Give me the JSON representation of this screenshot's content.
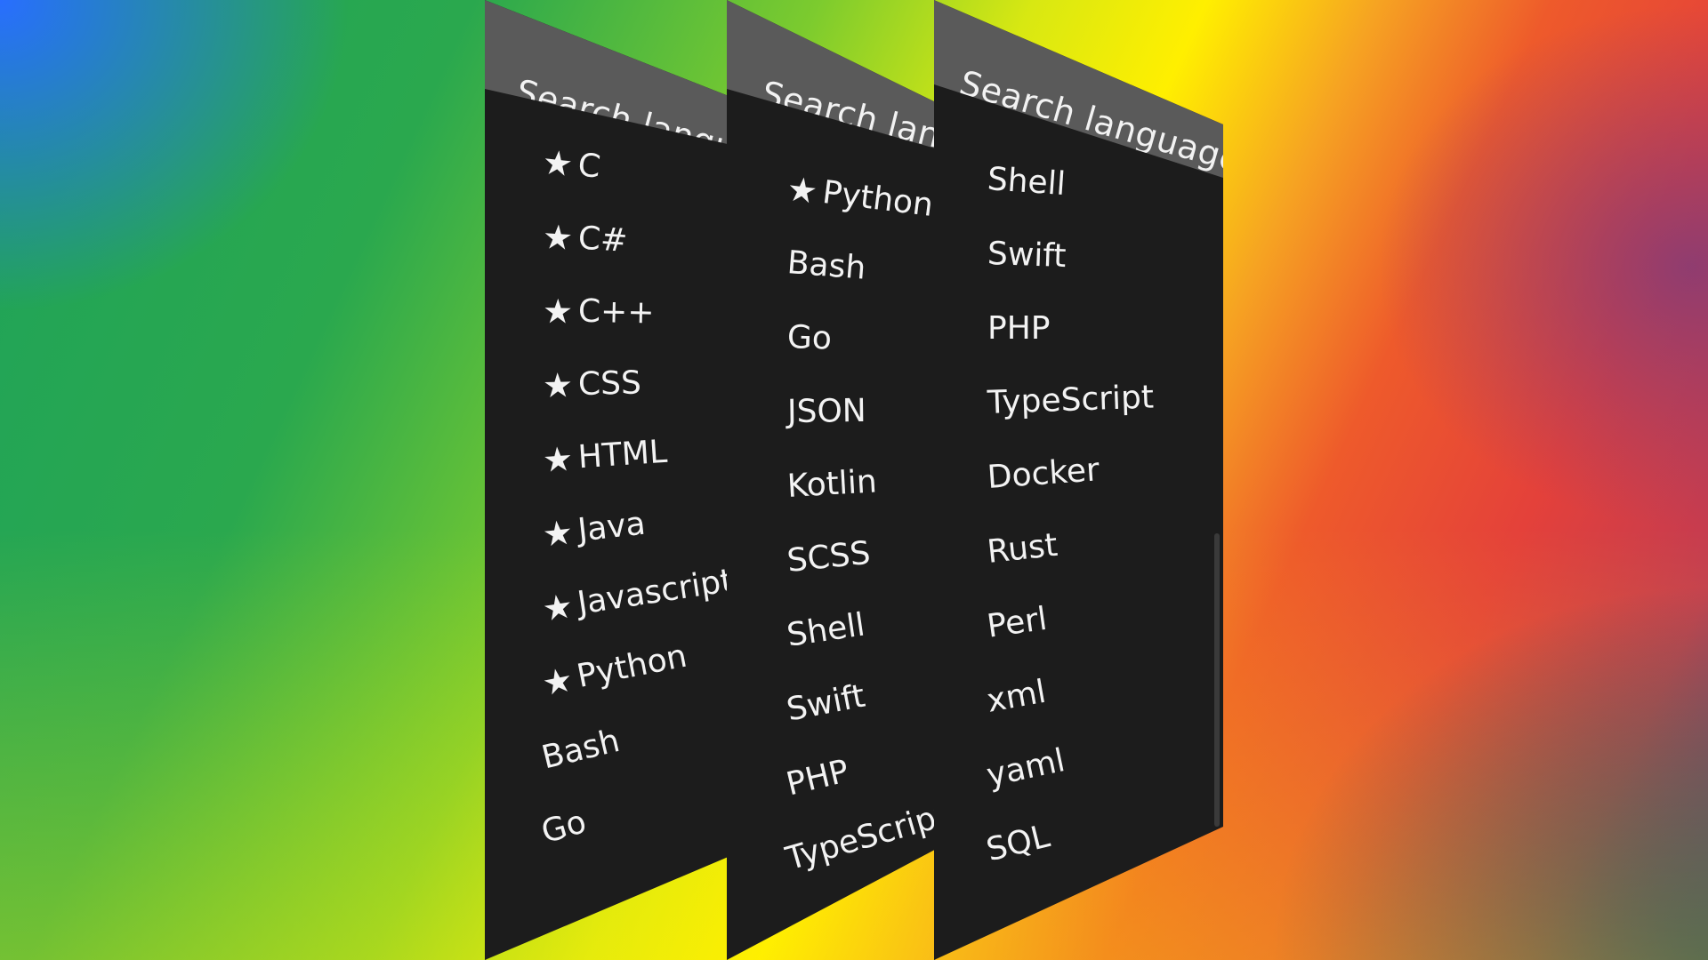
{
  "search": {
    "placeholder": "Search language"
  },
  "panel1": {
    "items": [
      {
        "label": "C",
        "favorite": true
      },
      {
        "label": "C#",
        "favorite": true
      },
      {
        "label": "C++",
        "favorite": true
      },
      {
        "label": "CSS",
        "favorite": true
      },
      {
        "label": "HTML",
        "favorite": true
      },
      {
        "label": "Java",
        "favorite": true
      },
      {
        "label": "Javascript",
        "favorite": true
      },
      {
        "label": "Python",
        "favorite": true
      },
      {
        "label": "Bash",
        "favorite": false
      },
      {
        "label": "Go",
        "favorite": false
      }
    ]
  },
  "panel2": {
    "items": [
      {
        "label": "Python",
        "favorite": true
      },
      {
        "label": "Bash",
        "favorite": false
      },
      {
        "label": "Go",
        "favorite": false
      },
      {
        "label": "JSON",
        "favorite": false
      },
      {
        "label": "Kotlin",
        "favorite": false
      },
      {
        "label": "SCSS",
        "favorite": false
      },
      {
        "label": "Shell",
        "favorite": false
      },
      {
        "label": "Swift",
        "favorite": false
      },
      {
        "label": "PHP",
        "favorite": false
      },
      {
        "label": "TypeScript",
        "favorite": false
      }
    ]
  },
  "panel3": {
    "items": [
      {
        "label": "Shell",
        "favorite": false
      },
      {
        "label": "Swift",
        "favorite": false
      },
      {
        "label": "PHP",
        "favorite": false
      },
      {
        "label": "TypeScript",
        "favorite": false
      },
      {
        "label": "Docker",
        "favorite": false
      },
      {
        "label": "Rust",
        "favorite": false
      },
      {
        "label": "Perl",
        "favorite": false
      },
      {
        "label": "xml",
        "favorite": false
      },
      {
        "label": "yaml",
        "favorite": false
      },
      {
        "label": "SQL",
        "favorite": false
      }
    ]
  },
  "icons": {
    "favorite": "star-icon"
  },
  "colors": {
    "panel_bg": "#1c1c1c",
    "header_bg": "#5a5a5a",
    "text": "#f3f3f3"
  }
}
